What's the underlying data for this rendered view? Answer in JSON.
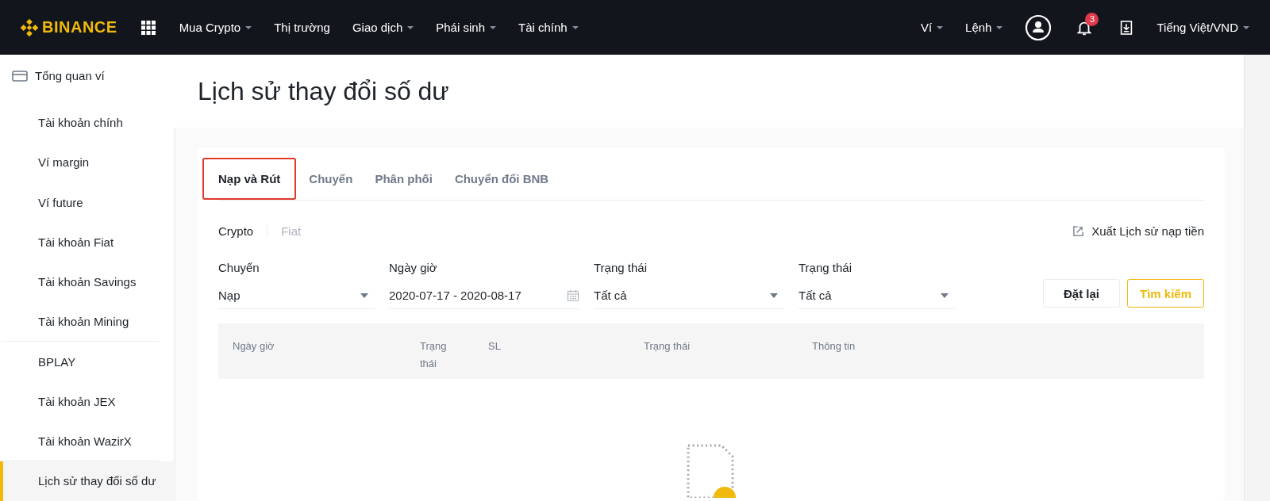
{
  "topbar": {
    "logo": "BINANCE",
    "nav": [
      {
        "label": "Mua Crypto",
        "dropdown": true
      },
      {
        "label": "Thị trường",
        "dropdown": false
      },
      {
        "label": "Giao dịch",
        "dropdown": true
      },
      {
        "label": "Phái sinh",
        "dropdown": true
      },
      {
        "label": "Tài chính",
        "dropdown": true
      }
    ],
    "right": [
      {
        "label": "Ví",
        "dropdown": true
      },
      {
        "label": "Lệnh",
        "dropdown": true
      }
    ],
    "notification_count": "3",
    "language": "Tiếng Việt/VND"
  },
  "sidebar": {
    "items": [
      {
        "label": "Tổng quan ví",
        "kind": "header",
        "selected": false
      },
      {
        "label": "Tài khoản chính",
        "kind": "item",
        "selected": false
      },
      {
        "label": "Ví margin",
        "kind": "item",
        "selected": false
      },
      {
        "label": "Ví future",
        "kind": "item",
        "selected": false
      },
      {
        "label": "Tài khoản Fiat",
        "kind": "item",
        "selected": false
      },
      {
        "label": "Tài khoản Savings",
        "kind": "item",
        "selected": false
      },
      {
        "label": "Tài khoản Mining",
        "kind": "item",
        "selected": false
      },
      {
        "label": "BPLAY",
        "kind": "item",
        "selected": false
      },
      {
        "label": "Tài khoản JEX",
        "kind": "item",
        "selected": false
      },
      {
        "label": "Tài khoản WazirX",
        "kind": "item",
        "selected": false
      },
      {
        "label": "Lịch sử thay đổi số dư",
        "kind": "item",
        "selected": true
      }
    ]
  },
  "page_title": "Lịch sử thay đổi số dư",
  "tabs": [
    {
      "label": "Nạp và Rút",
      "selected": true
    },
    {
      "label": "Chuyển",
      "selected": false
    },
    {
      "label": "Phân phối",
      "selected": false
    },
    {
      "label": "Chuyển đổi BNB",
      "selected": false
    }
  ],
  "segments": [
    {
      "label": "Crypto",
      "selected": true
    },
    {
      "label": "Fiat",
      "selected": false
    }
  ],
  "export_link": "Xuất Lịch sử nạp tiền",
  "filters": [
    {
      "label": "Chuyển",
      "value": "Nạp",
      "kind": "select"
    },
    {
      "label": "Ngày giờ",
      "value": "2020-07-17 - 2020-08-17",
      "kind": "date"
    },
    {
      "label": "Trạng thái",
      "value": "Tất cả",
      "kind": "select"
    },
    {
      "label": "Trạng thái",
      "value": "Tất cả",
      "kind": "select"
    }
  ],
  "buttons": [
    {
      "label": "Đặt lại",
      "kind": "secondary"
    },
    {
      "label": "Tìm kiếm",
      "kind": "primary"
    }
  ],
  "table": {
    "columns": [
      "Ngày giờ",
      "Trạng thái",
      "SL",
      "Trạng thái",
      "Thông tin"
    ]
  }
}
